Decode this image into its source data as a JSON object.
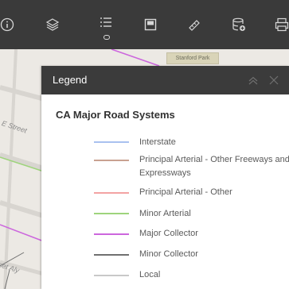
{
  "toolbar": {
    "tools": [
      {
        "icon": "info-icon"
      },
      {
        "icon": "layers-icon"
      },
      {
        "icon": "legend-list-icon",
        "active": true
      },
      {
        "icon": "basemap-icon"
      },
      {
        "icon": "measure-icon"
      },
      {
        "icon": "database-add-icon"
      },
      {
        "icon": "print-icon"
      }
    ]
  },
  "map": {
    "labels": {
      "e_street": "E Street",
      "alley": "set Aly",
      "park": "Stanford Park"
    }
  },
  "legend": {
    "title": "Legend",
    "layer_title": "CA Major Road Systems",
    "items": [
      {
        "label": "Interstate",
        "color": "#a9c1ef"
      },
      {
        "label": "Principal Arterial - Other Freeways and Expressways",
        "color": "#c9a191"
      },
      {
        "label": "Principal Arterial - Other",
        "color": "#f3a3a3"
      },
      {
        "label": "Minor Arterial",
        "color": "#9ed47c"
      },
      {
        "label": "Major Collector",
        "color": "#cc66dd"
      },
      {
        "label": "Minor Collector",
        "color": "#707070"
      },
      {
        "label": "Local",
        "color": "#c8c8c8"
      }
    ]
  }
}
